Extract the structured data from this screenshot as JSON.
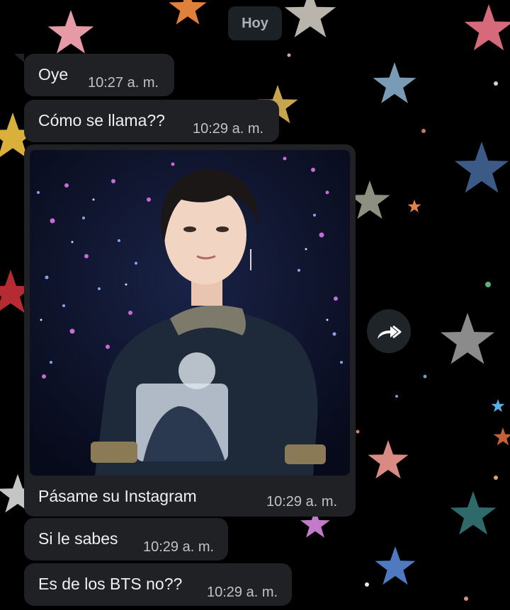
{
  "chat": {
    "date_separator": "Hoy",
    "messages": [
      {
        "text": "Oye",
        "time": "10:27 a. m."
      },
      {
        "text": "Cómo se llama??",
        "time": "10:29 a. m."
      },
      {
        "text": "Pásame su Instagram",
        "time": "10:29 a. m.",
        "has_image": true
      },
      {
        "text": "Si le sabes",
        "time": "10:29 a. m."
      },
      {
        "text": "Es de los BTS no??",
        "time": "10:29 a. m."
      }
    ]
  },
  "icons": {
    "forward": "forward-icon",
    "wallpaper": "stars-wallpaper"
  },
  "colors": {
    "bubble": "#202124",
    "date_chip": "#1b2125",
    "background": "#000000"
  }
}
